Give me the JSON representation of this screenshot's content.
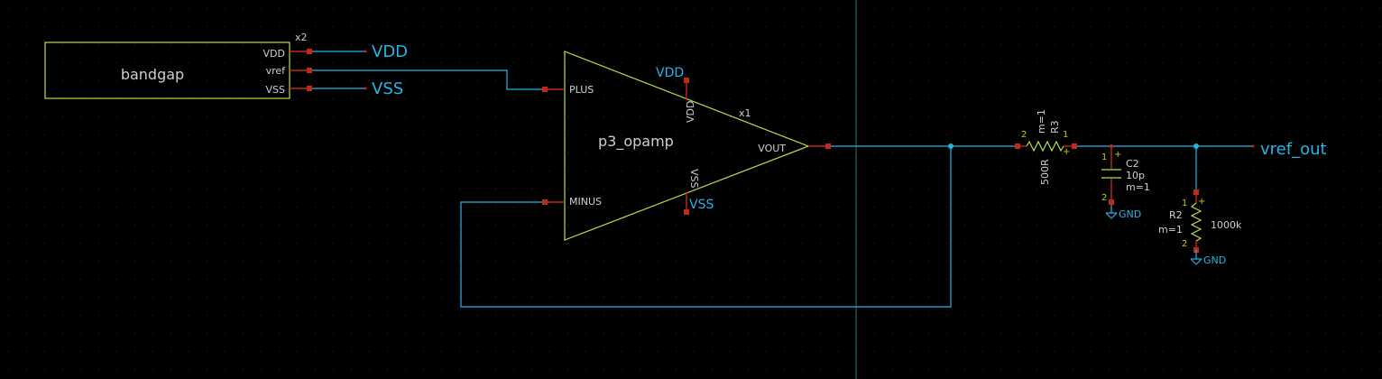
{
  "bandgap": {
    "name": "bandgap",
    "inst": "x2",
    "pins": [
      "VDD",
      "vref",
      "VSS"
    ]
  },
  "opamp": {
    "name": "p3_opamp",
    "inst": "x1",
    "pins": {
      "plus": "PLUS",
      "minus": "MINUS",
      "vout": "VOUT",
      "vdd": "VDD",
      "vss": "VSS"
    }
  },
  "nets": {
    "vdd_top": "VDD",
    "vss_top": "VSS",
    "vdd_opamp": "VDD",
    "vss_opamp": "VSS",
    "output": "vref_out",
    "gnd1": "GND",
    "gnd2": "GND"
  },
  "r3": {
    "name": "R3",
    "value": "500R",
    "mult": "m=1",
    "pin2": "2",
    "pin1": "1",
    "plus": "+"
  },
  "c2": {
    "name": "C2",
    "value": "10p",
    "mult": "m=1",
    "pin1": "1",
    "pin2": "2",
    "plus": "+"
  },
  "r2": {
    "name": "R2",
    "value": "1000k",
    "mult": "m=1",
    "pin1": "1",
    "pin2": "2",
    "plus": "+"
  },
  "colors": {
    "background": "#000000",
    "wire": "#29b3e6",
    "symbol": "#b6e04a",
    "pin": "#c02a1a",
    "text": "#cfcfcf",
    "pin_number": "#c8c800"
  }
}
